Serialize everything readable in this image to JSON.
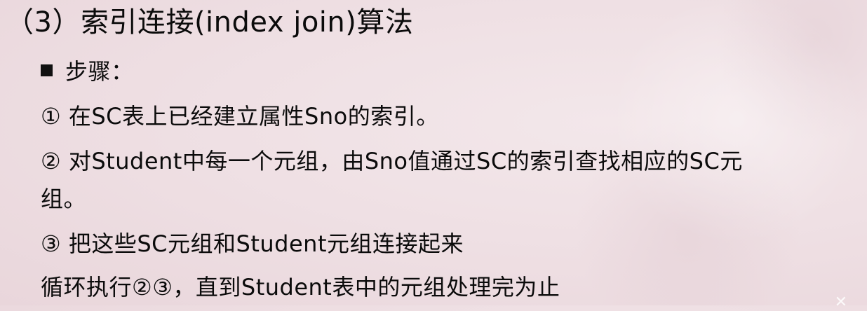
{
  "slide": {
    "title": "（3）索引连接(index join)算法",
    "bullet_heading": "步骤：",
    "step1": "① 在SC表上已经建立属性Sno的索引。",
    "step2_line1": "② 对Student中每一个元组，由Sno值通过SC的索引查找相应的SC元",
    "step2_line2": "组。",
    "step3": "③ 把这些SC元组和Student元组连接起来",
    "loop": "循环执行②③，直到Student表中的元组处理完为止"
  }
}
